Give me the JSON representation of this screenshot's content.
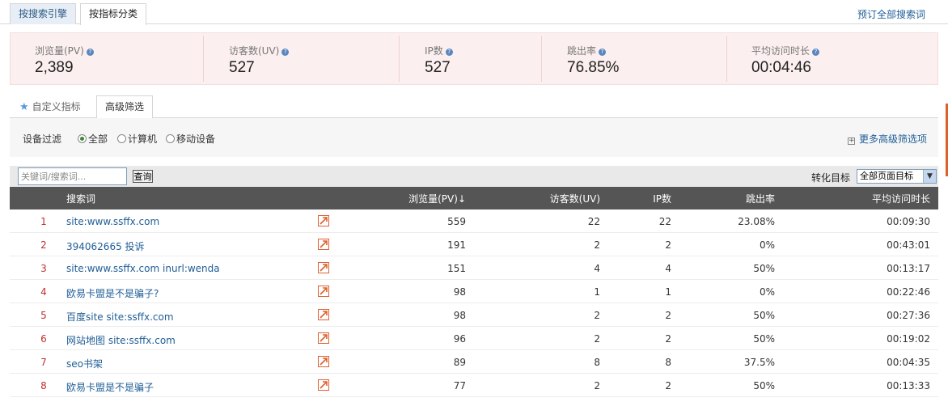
{
  "top_tabs": [
    "按搜索引擎",
    "按指标分类"
  ],
  "subscribe_link": "预订全部搜索词",
  "metrics": [
    {
      "label": "浏览量(PV)",
      "value": "2,389"
    },
    {
      "label": "访客数(UV)",
      "value": "527"
    },
    {
      "label": "IP数",
      "value": "527"
    },
    {
      "label": "跳出率",
      "value": "76.85%"
    },
    {
      "label": "平均访问时长",
      "value": "00:04:46"
    }
  ],
  "help_glyph": "?",
  "filter_tabs": {
    "custom": "自定义指标",
    "advanced": "高级筛选"
  },
  "device_filter": {
    "label": "设备过滤",
    "options": [
      "全部",
      "计算机",
      "移动设备"
    ],
    "selected": 0
  },
  "more_filters": "更多高级筛选项",
  "search": {
    "placeholder": "关键词/搜索词...",
    "button": "查询"
  },
  "conversion": {
    "label": "转化目标",
    "selected": "全部页面目标"
  },
  "table": {
    "headers": {
      "keyword": "搜索词",
      "pv": "浏览量(PV)",
      "pv_sort": "↓",
      "uv": "访客数(UV)",
      "ip": "IP数",
      "bounce": "跳出率",
      "duration": "平均访问时长"
    },
    "rows": [
      {
        "rank": "1",
        "keyword": "site:www.ssffx.com",
        "pv": "559",
        "uv": "22",
        "ip": "22",
        "bounce": "23.08%",
        "duration": "00:09:30"
      },
      {
        "rank": "2",
        "keyword": "394062665 投诉",
        "pv": "191",
        "uv": "2",
        "ip": "2",
        "bounce": "0%",
        "duration": "00:43:01"
      },
      {
        "rank": "3",
        "keyword": "site:www.ssffx.com inurl:wenda",
        "pv": "151",
        "uv": "4",
        "ip": "4",
        "bounce": "50%",
        "duration": "00:13:17"
      },
      {
        "rank": "4",
        "keyword": "欧易卡盟是不是骗子?",
        "pv": "98",
        "uv": "1",
        "ip": "1",
        "bounce": "0%",
        "duration": "00:22:46"
      },
      {
        "rank": "5",
        "keyword": "百度site site:ssffx.com",
        "pv": "98",
        "uv": "2",
        "ip": "2",
        "bounce": "50%",
        "duration": "00:27:36"
      },
      {
        "rank": "6",
        "keyword": "网站地图 site:ssffx.com",
        "pv": "96",
        "uv": "2",
        "ip": "2",
        "bounce": "50%",
        "duration": "00:19:02"
      },
      {
        "rank": "7",
        "keyword": "seo书架",
        "pv": "89",
        "uv": "8",
        "ip": "8",
        "bounce": "37.5%",
        "duration": "00:04:35"
      },
      {
        "rank": "8",
        "keyword": "欧易卡盟是不是骗子",
        "pv": "77",
        "uv": "2",
        "ip": "2",
        "bounce": "50%",
        "duration": "00:13:33"
      }
    ]
  },
  "colors": {
    "accent": "#1f5d96",
    "rank": "#c03030",
    "header_bg": "#555555",
    "metrics_bg": "#fcefef",
    "trend": "#e06030"
  }
}
